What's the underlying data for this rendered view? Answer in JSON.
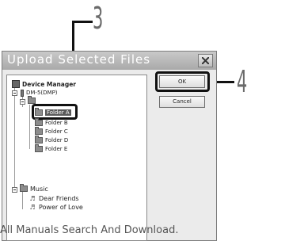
{
  "callouts": {
    "three": "3",
    "four": "4"
  },
  "dialog": {
    "title": "Upload Selected Files",
    "ok_label": "OK",
    "cancel_label": "Cancel"
  },
  "tree": {
    "device_manager": "Device Manager",
    "device": "DM-5(DMP)",
    "folders": [
      "Folder A",
      "Folder B",
      "Folder C",
      "Folder D",
      "Folder E"
    ],
    "music": "Music",
    "songs": [
      "Dear Friends",
      "Power of Love"
    ]
  },
  "caption": "All Manuals Search And Download."
}
